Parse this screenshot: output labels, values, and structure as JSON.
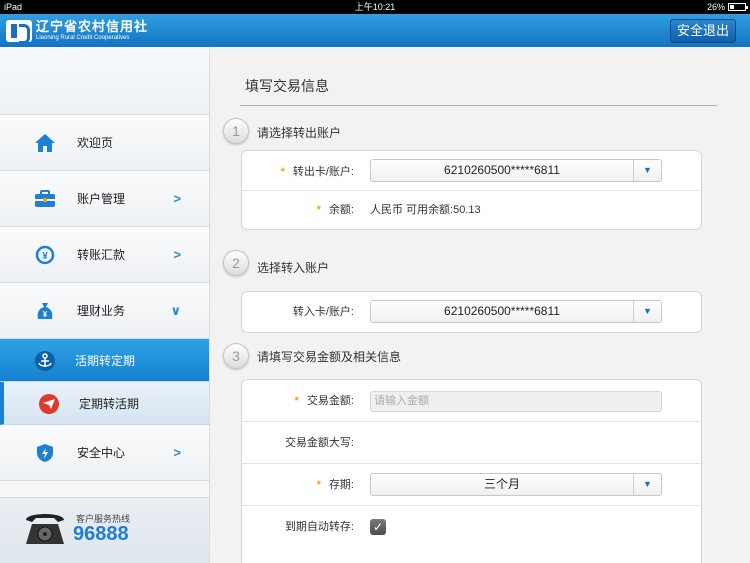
{
  "status_bar": {
    "device": "iPad",
    "time": "上午10:21",
    "battery": "26%",
    "battery_level": 0.26
  },
  "header": {
    "logo_cn": "辽宁省农村信用社",
    "logo_en": "Liaoning Rural Credit Cooperatives",
    "logout_label": "安全退出"
  },
  "sidebar": {
    "items": [
      {
        "label": "欢迎页",
        "icon": "home-icon"
      },
      {
        "label": "账户管理",
        "icon": "briefcase-icon",
        "arrow": ">"
      },
      {
        "label": "转账汇款",
        "icon": "transfer-icon",
        "arrow": ">"
      },
      {
        "label": "理财业务",
        "icon": "money-bag-icon",
        "arrow": "∨"
      },
      {
        "label": "安全中心",
        "icon": "shield-icon",
        "arrow": ">"
      }
    ],
    "sub_items": [
      {
        "label": "活期转定期",
        "icon": "anchor-icon",
        "active": true
      },
      {
        "label": "定期转活期",
        "icon": "plane-icon",
        "active": false
      }
    ],
    "hotline": {
      "label": "客户服务热线",
      "number": "96888"
    }
  },
  "main": {
    "title": "填写交易信息",
    "steps": [
      {
        "number": "1",
        "title": "请选择转出账户"
      },
      {
        "number": "2",
        "title": "选择转入账户"
      },
      {
        "number": "3",
        "title": "请填写交易金额及相关信息"
      }
    ],
    "step1": {
      "card_label": "转出卡/账户:",
      "card_value": "6210260500*****6811",
      "balance_label": "余额:",
      "balance_value": "人民币 可用余额:50.13"
    },
    "step2": {
      "card_label": "转入卡/账户:",
      "card_value": "6210260500*****6811"
    },
    "step3": {
      "amount_label": "交易金额:",
      "amount_placeholder": "请输入金额",
      "amount_upper_label": "交易金额大写:",
      "term_label": "存期:",
      "term_value": "三个月",
      "auto_renew_label": "到期自动转存:",
      "auto_renew_checked": true
    },
    "required_mark": "*",
    "select_arrow": "▼"
  },
  "colors": {
    "accent": "#1e7fd0",
    "header": "#1a7cc8",
    "required": "#f2a31b"
  }
}
